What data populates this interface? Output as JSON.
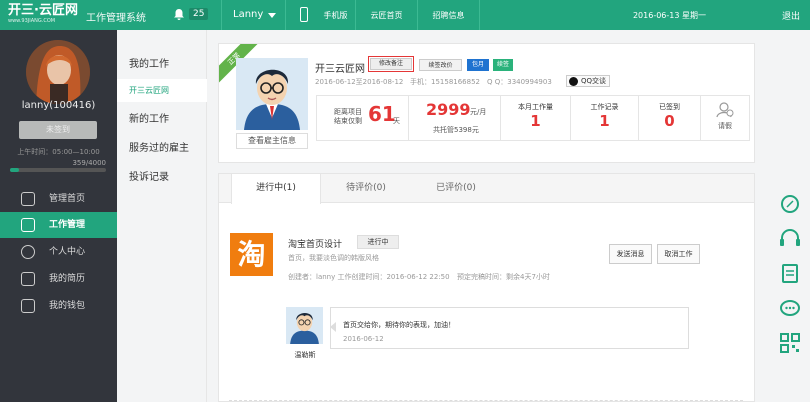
{
  "topbar": {
    "logo_main": "开三·云匠网",
    "logo_sub": "www.93JIANG.COM",
    "system_name": "工作管理系统",
    "notif_count": "25",
    "user": "Lanny",
    "nav": [
      "手机版",
      "云匠首页",
      "招聘信息"
    ],
    "date": "2016-06-13 星期一",
    "exit": "退出"
  },
  "sidebar": {
    "username": "lanny(100416)",
    "checkin_label": "未签到",
    "worktime": "上午时间：05:00—10:00",
    "progress_text": "359/4000",
    "progress_fraction": 0.09,
    "menu": [
      "管理首页",
      "工作管理",
      "个人中心",
      "我的简历",
      "我的钱包"
    ]
  },
  "subnav": [
    "我的工作",
    "开三云匠网",
    "新的工作",
    "服务过的雇主",
    "投诉记录"
  ],
  "employer": {
    "ribbon": "正常",
    "name": "开三云匠网",
    "view_btn": "查看雇主信息",
    "btn_edit_note": "修改备注",
    "btn_renew": "续签改价",
    "tag_month": "包月",
    "tag_renewed": "续签",
    "period": "2016-06-12至2016-08-12",
    "phone": "手机：15158166852",
    "qq": "Q Q：3340994903",
    "qq_btn": "QQ交谈",
    "end_label_1": "距离项目",
    "end_label_2": "结束仅剩",
    "end_days": "61",
    "end_unit": "天",
    "price": "2999",
    "price_unit": "元/月",
    "paid": "共托管5398元",
    "stats": [
      {
        "label": "本月工作量",
        "value": "1"
      },
      {
        "label": "工作记录",
        "value": "1"
      },
      {
        "label": "已签到",
        "value": "0"
      }
    ],
    "leave": "请假"
  },
  "tabs": [
    "进行中(1)",
    "待评价(0)",
    "已评价(0)"
  ],
  "job": {
    "icon_char": "淘",
    "title": "淘宝首页设计",
    "status": "进行中",
    "desc": "首页，我要淡色调的韩版风格",
    "creator": "创建者：lanny 工作创建时间：2016-06-12 22:50",
    "deadline": "预定完稿时间：剩余4天7小时",
    "btn_send": "发送消息",
    "btn_cancel": "取消工作"
  },
  "comment": {
    "name": "温勒斯",
    "text": "首页交给你，期待你的表现，加油！",
    "date": "2016-06-12"
  },
  "colors": {
    "primary": "#22a57e",
    "sidebar": "#32353c",
    "accent_red": "#e43636",
    "orange": "#f07d0f"
  }
}
